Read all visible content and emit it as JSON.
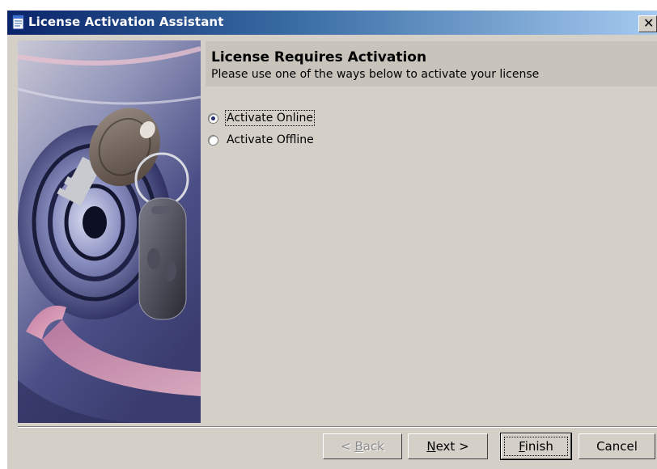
{
  "window": {
    "title": "License Activation Assistant",
    "close_glyph": "✕"
  },
  "header": {
    "title": "License Requires Activation",
    "subtitle": "Please use one of the ways below to activate your license"
  },
  "options": [
    {
      "label": "Activate Online",
      "selected": true
    },
    {
      "label": "Activate Offline",
      "selected": false
    }
  ],
  "buttons": {
    "back": {
      "label_prefix": "< ",
      "mnemonic": "B",
      "label_rest": "ack",
      "enabled": false
    },
    "next": {
      "mnemonic": "N",
      "label_rest": "ext >",
      "enabled": true
    },
    "finish": {
      "mnemonic": "F",
      "label_rest": "inish",
      "enabled": true,
      "default": true
    },
    "cancel": {
      "label": "Cancel",
      "enabled": true
    }
  },
  "side_image": {
    "icon": "keys-and-disc-illustration"
  },
  "colors": {
    "title_bar_start": "#0a246a",
    "title_bar_end": "#a6caf0",
    "dialog_face": "#d4d0c8",
    "header_panel": "#c8c4bc"
  }
}
